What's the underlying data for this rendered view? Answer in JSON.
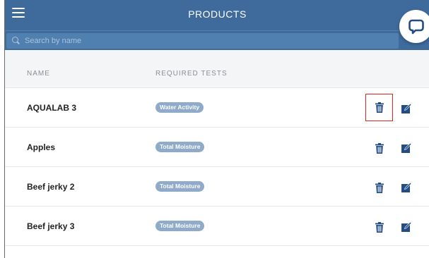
{
  "header": {
    "title": "PRODUCTS"
  },
  "search": {
    "placeholder": "Search by name",
    "value": ""
  },
  "columns": {
    "name": "NAME",
    "tests": "REQUIRED TESTS"
  },
  "products": [
    {
      "name": "AQUALAB 3",
      "test": "Water Activity",
      "highlighted": true
    },
    {
      "name": "Apples",
      "test": "Total Moisture",
      "highlighted": false
    },
    {
      "name": "Beef jerky 2",
      "test": "Total Moisture",
      "highlighted": false
    },
    {
      "name": "Beef jerky 3",
      "test": "Total Moisture",
      "highlighted": false
    }
  ],
  "icons": {
    "menu": "hamburger-icon",
    "search": "search-icon",
    "chat": "chat-icon",
    "delete": "trash-icon",
    "edit": "edit-icon"
  },
  "colors": {
    "header": "#3e6b9b",
    "search_field": "#5080b0",
    "tag": "#8fabc9",
    "icon": "#234d82",
    "highlight": "#e0241b"
  }
}
